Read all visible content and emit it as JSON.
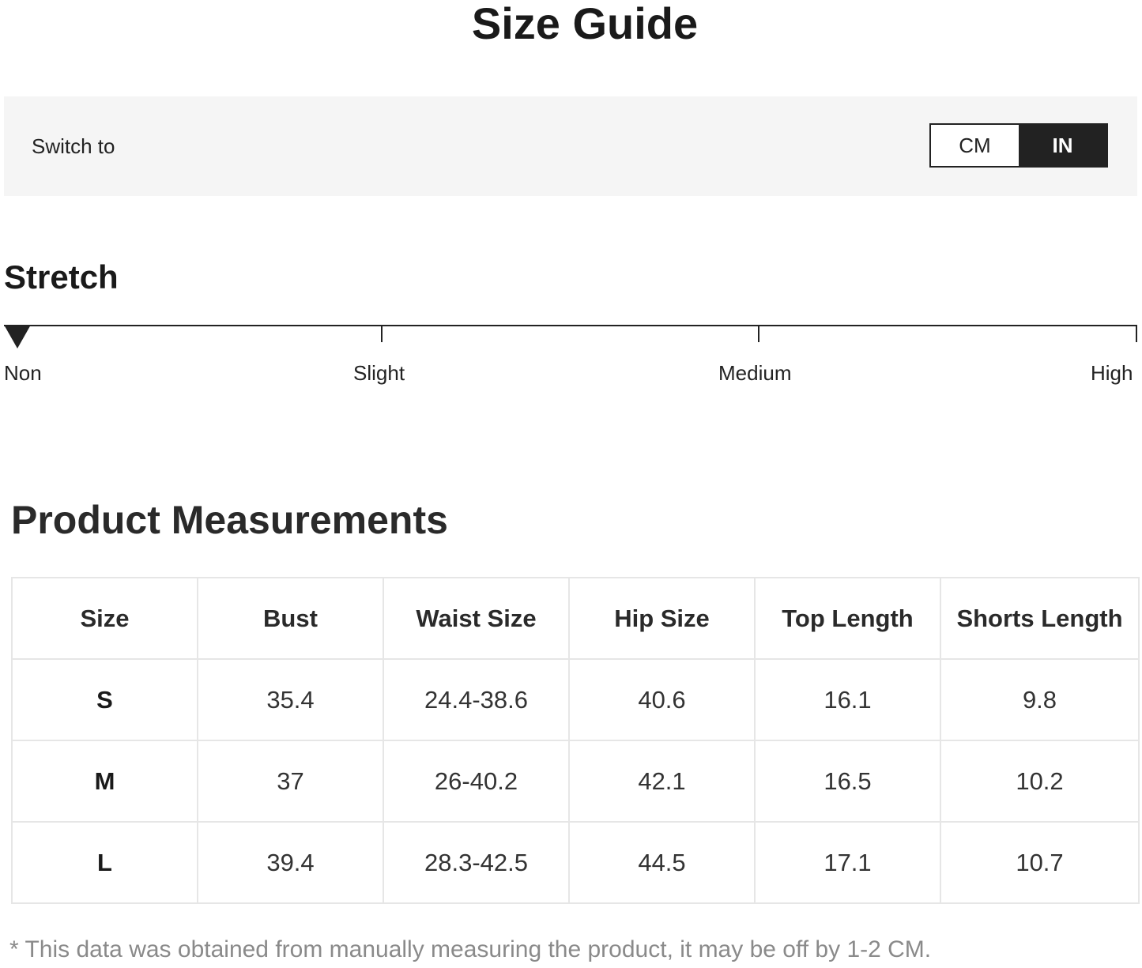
{
  "page_title": "Size Guide",
  "switch": {
    "label": "Switch to",
    "options": [
      "CM",
      "IN"
    ],
    "selected": "IN"
  },
  "stretch": {
    "title": "Stretch",
    "levels": [
      "Non",
      "Slight",
      "Medium",
      "High"
    ],
    "current": "Non"
  },
  "measurements": {
    "title": "Product Measurements",
    "headers": [
      "Size",
      "Bust",
      "Waist Size",
      "Hip Size",
      "Top Length",
      "Shorts Length"
    ],
    "rows": [
      [
        "S",
        "35.4",
        "24.4-38.6",
        "40.6",
        "16.1",
        "9.8"
      ],
      [
        "M",
        "37",
        "26-40.2",
        "42.1",
        "16.5",
        "10.2"
      ],
      [
        "L",
        "39.4",
        "28.3-42.5",
        "44.5",
        "17.1",
        "10.7"
      ]
    ]
  },
  "footnote": "* This data was obtained from manually measuring the product, it may be off by 1-2 CM.",
  "colors": {
    "active_toggle": "#222222",
    "panel_background": "#f5f5f5",
    "table_border": "#e6e6e6"
  }
}
